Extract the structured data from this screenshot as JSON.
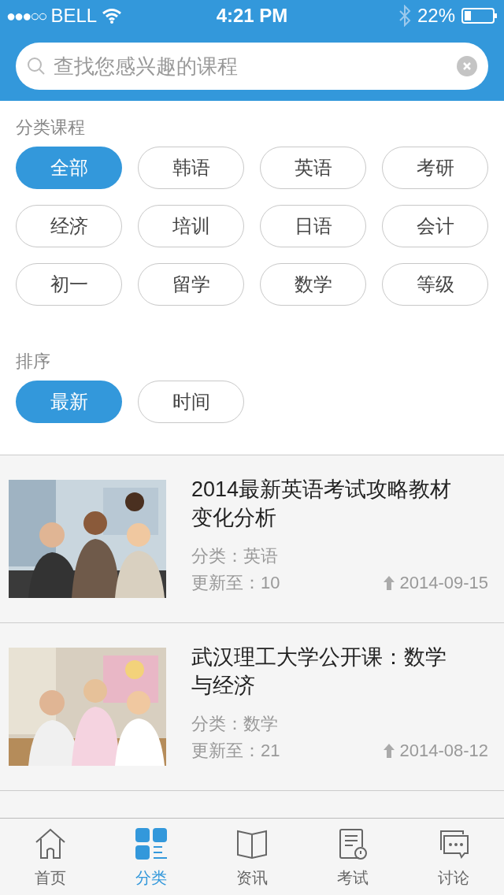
{
  "status_bar": {
    "signal": "●●●○○",
    "carrier": "BELL",
    "time": "4:21 PM",
    "battery": "22%"
  },
  "search": {
    "placeholder": "查找您感兴趣的课程"
  },
  "categories": {
    "title": "分类课程",
    "items": [
      {
        "label": "全部",
        "selected": true
      },
      {
        "label": "韩语",
        "selected": false
      },
      {
        "label": "英语",
        "selected": false
      },
      {
        "label": "考研",
        "selected": false
      },
      {
        "label": "经济",
        "selected": false
      },
      {
        "label": "培训",
        "selected": false
      },
      {
        "label": "日语",
        "selected": false
      },
      {
        "label": "会计",
        "selected": false
      },
      {
        "label": "初一",
        "selected": false
      },
      {
        "label": "留学",
        "selected": false
      },
      {
        "label": "数学",
        "selected": false
      },
      {
        "label": "等级",
        "selected": false
      }
    ]
  },
  "sort": {
    "title": "排序",
    "items": [
      {
        "label": "最新",
        "selected": true
      },
      {
        "label": "时间",
        "selected": false
      }
    ]
  },
  "courses": [
    {
      "title": "2014最新英语考试攻略教材变化分析",
      "category": "分类：英语",
      "updated": "更新至：10",
      "date": "2014-09-15"
    },
    {
      "title": "武汉理工大学公开课：数学与经济",
      "category": "分类：数学",
      "updated": "更新至：21",
      "date": "2014-08-12"
    }
  ],
  "tab_bar": [
    {
      "label": "首页",
      "selected": false
    },
    {
      "label": "分类",
      "selected": true
    },
    {
      "label": "资讯",
      "selected": false
    },
    {
      "label": "考试",
      "selected": false
    },
    {
      "label": "讨论",
      "selected": false
    }
  ]
}
